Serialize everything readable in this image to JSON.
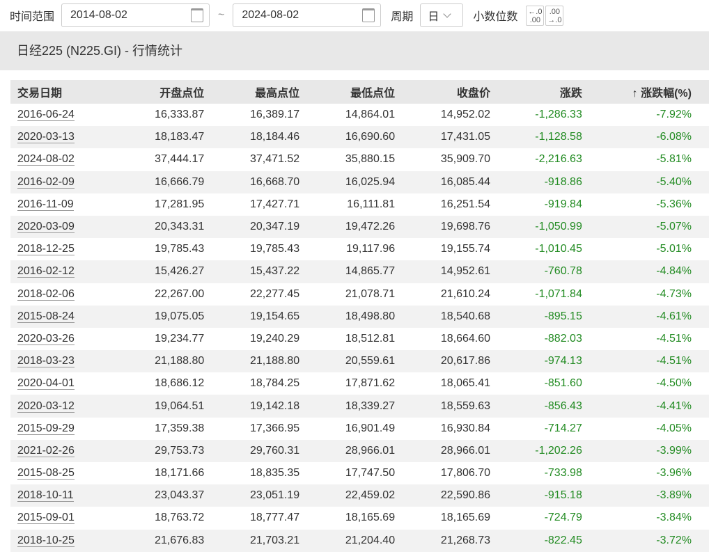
{
  "toolbar": {
    "range_label": "时间范围",
    "start": "2014-08-02",
    "sep": "~",
    "end": "2024-08-02",
    "period_label": "周期",
    "period": "日",
    "decimals_label": "小数位数",
    "dec_decrease": "←.0 .00",
    "dec_increase": ".00 →.0"
  },
  "title": "日经225 (N225.GI) - 行情统计",
  "table": {
    "headers": [
      "交易日期",
      "开盘点位",
      "最高点位",
      "最低点位",
      "收盘价",
      "涨跌",
      "↑ 涨跌幅(%)"
    ],
    "rows": [
      [
        "2016-06-24",
        "16,333.87",
        "16,389.17",
        "14,864.01",
        "14,952.02",
        "-1,286.33",
        "-7.92%"
      ],
      [
        "2020-03-13",
        "18,183.47",
        "18,184.46",
        "16,690.60",
        "17,431.05",
        "-1,128.58",
        "-6.08%"
      ],
      [
        "2024-08-02",
        "37,444.17",
        "37,471.52",
        "35,880.15",
        "35,909.70",
        "-2,216.63",
        "-5.81%"
      ],
      [
        "2016-02-09",
        "16,666.79",
        "16,668.70",
        "16,025.94",
        "16,085.44",
        "-918.86",
        "-5.40%"
      ],
      [
        "2016-11-09",
        "17,281.95",
        "17,427.71",
        "16,111.81",
        "16,251.54",
        "-919.84",
        "-5.36%"
      ],
      [
        "2020-03-09",
        "20,343.31",
        "20,347.19",
        "19,472.26",
        "19,698.76",
        "-1,050.99",
        "-5.07%"
      ],
      [
        "2018-12-25",
        "19,785.43",
        "19,785.43",
        "19,117.96",
        "19,155.74",
        "-1,010.45",
        "-5.01%"
      ],
      [
        "2016-02-12",
        "15,426.27",
        "15,437.22",
        "14,865.77",
        "14,952.61",
        "-760.78",
        "-4.84%"
      ],
      [
        "2018-02-06",
        "22,267.00",
        "22,277.45",
        "21,078.71",
        "21,610.24",
        "-1,071.84",
        "-4.73%"
      ],
      [
        "2015-08-24",
        "19,075.05",
        "19,154.65",
        "18,498.80",
        "18,540.68",
        "-895.15",
        "-4.61%"
      ],
      [
        "2020-03-26",
        "19,234.77",
        "19,240.29",
        "18,512.81",
        "18,664.60",
        "-882.03",
        "-4.51%"
      ],
      [
        "2018-03-23",
        "21,188.80",
        "21,188.80",
        "20,559.61",
        "20,617.86",
        "-974.13",
        "-4.51%"
      ],
      [
        "2020-04-01",
        "18,686.12",
        "18,784.25",
        "17,871.62",
        "18,065.41",
        "-851.60",
        "-4.50%"
      ],
      [
        "2020-03-12",
        "19,064.51",
        "19,142.18",
        "18,339.27",
        "18,559.63",
        "-856.43",
        "-4.41%"
      ],
      [
        "2015-09-29",
        "17,359.38",
        "17,366.95",
        "16,901.49",
        "16,930.84",
        "-714.27",
        "-4.05%"
      ],
      [
        "2021-02-26",
        "29,753.73",
        "29,760.31",
        "28,966.01",
        "28,966.01",
        "-1,202.26",
        "-3.99%"
      ],
      [
        "2015-08-25",
        "18,171.66",
        "18,835.35",
        "17,747.50",
        "17,806.70",
        "-733.98",
        "-3.96%"
      ],
      [
        "2018-10-11",
        "23,043.37",
        "23,051.19",
        "22,459.02",
        "22,590.86",
        "-915.18",
        "-3.89%"
      ],
      [
        "2015-09-01",
        "18,763.72",
        "18,777.47",
        "18,165.69",
        "18,165.69",
        "-724.79",
        "-3.84%"
      ],
      [
        "2018-10-25",
        "21,676.83",
        "21,703.21",
        "21,204.40",
        "21,268.73",
        "-822.45",
        "-3.72%"
      ]
    ]
  },
  "colors": {
    "down": "#228b22",
    "header_bg": "#e8e8e8"
  }
}
